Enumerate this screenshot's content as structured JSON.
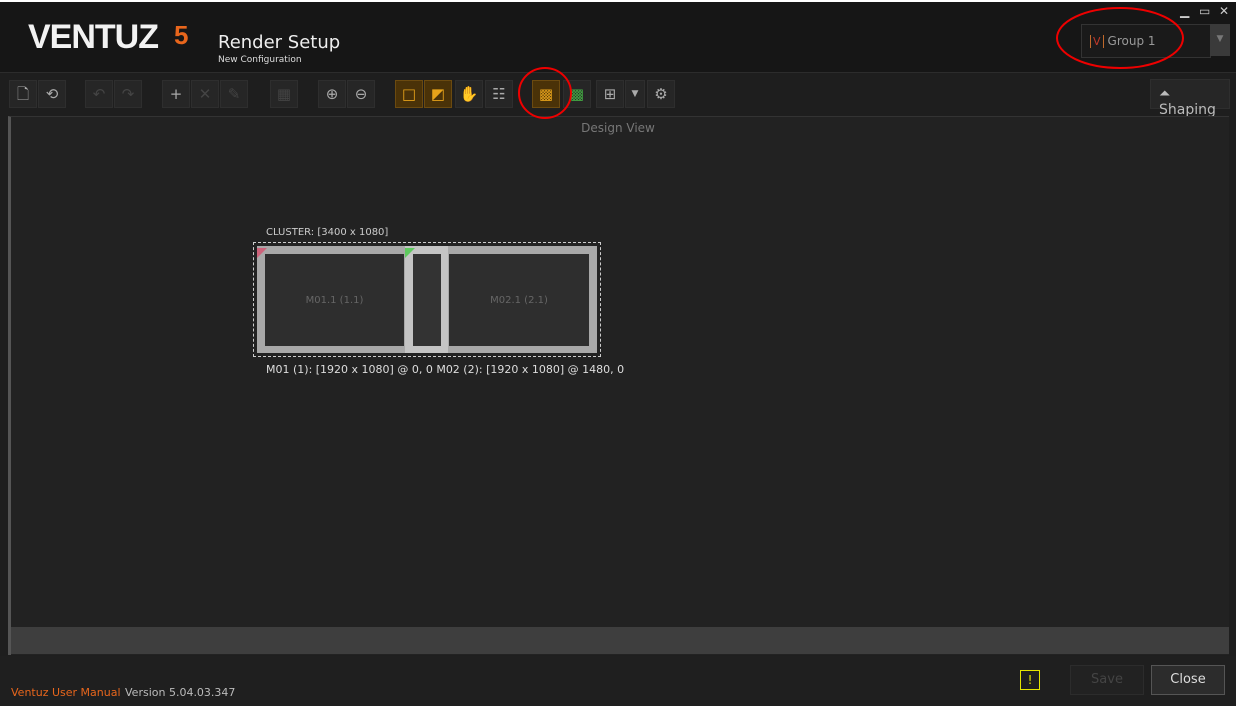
{
  "app": {
    "logo": "VENTUZ",
    "logo_mark": "5",
    "title": "Render Setup",
    "subtitle": "New Configuration"
  },
  "window": {
    "minimize": "▁",
    "maximize": "▭",
    "close": "✕"
  },
  "group_selector": {
    "icon": "V",
    "value": "Group 1",
    "arrow": "▼"
  },
  "toolbar": {
    "shaping_label": "Shaping"
  },
  "design_view": {
    "label": "Design View",
    "cluster_label": "CLUSTER: [3400 x 1080]",
    "monitors": [
      {
        "label": "M01.1 (1.1)"
      },
      {
        "label": "M02.1 (2.1)"
      }
    ],
    "info": "M01 (1): [1920 x 1080] @ 0, 0 M02 (2): [1920 x 1080] @ 1480, 0"
  },
  "footer": {
    "manual_link": "Ventuz User Manual",
    "version": "Version 5.04.03.347",
    "warning": "!",
    "save": "Save",
    "close": "Close"
  }
}
